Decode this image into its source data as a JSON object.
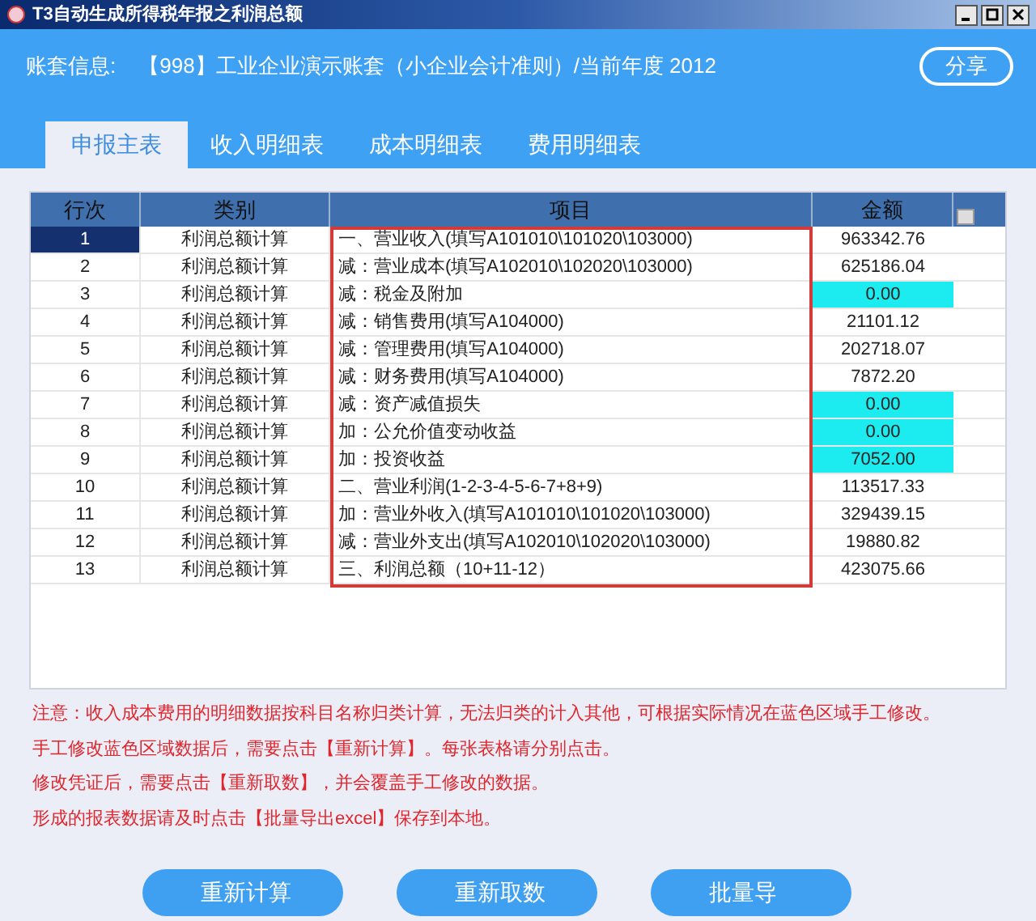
{
  "window": {
    "title": "T3自动生成所得税年报之利润总额"
  },
  "account": {
    "label": "账套信息:",
    "value": "【998】工业企业演示账套（小企业会计准则）/当前年度 2012"
  },
  "share_button": "分享",
  "tabs": [
    {
      "label": "申报主表",
      "selected": true
    },
    {
      "label": "收入明细表",
      "selected": false
    },
    {
      "label": "成本明细表",
      "selected": false
    },
    {
      "label": "费用明细表",
      "selected": false
    }
  ],
  "table": {
    "columns": [
      "行次",
      "类别",
      "项目",
      "金额"
    ],
    "rows": [
      {
        "no": "1",
        "category": "利润总额计算",
        "item": "一、营业收入(填写A101010\\101020\\103000)",
        "amount": "963342.76",
        "selected": true,
        "editable": false
      },
      {
        "no": "2",
        "category": "利润总额计算",
        "item": "减：营业成本(填写A102010\\102020\\103000)",
        "amount": "625186.04",
        "selected": false,
        "editable": false
      },
      {
        "no": "3",
        "category": "利润总额计算",
        "item": "减：税金及附加",
        "amount": "0.00",
        "selected": false,
        "editable": true
      },
      {
        "no": "4",
        "category": "利润总额计算",
        "item": "减：销售费用(填写A104000)",
        "amount": "21101.12",
        "selected": false,
        "editable": false
      },
      {
        "no": "5",
        "category": "利润总额计算",
        "item": "减：管理费用(填写A104000)",
        "amount": "202718.07",
        "selected": false,
        "editable": false
      },
      {
        "no": "6",
        "category": "利润总额计算",
        "item": "减：财务费用(填写A104000)",
        "amount": "7872.20",
        "selected": false,
        "editable": false
      },
      {
        "no": "7",
        "category": "利润总额计算",
        "item": "减：资产减值损失",
        "amount": "0.00",
        "selected": false,
        "editable": true
      },
      {
        "no": "8",
        "category": "利润总额计算",
        "item": "加：公允价值变动收益",
        "amount": "0.00",
        "selected": false,
        "editable": true
      },
      {
        "no": "9",
        "category": "利润总额计算",
        "item": "加：投资收益",
        "amount": "7052.00",
        "selected": false,
        "editable": true
      },
      {
        "no": "10",
        "category": "利润总额计算",
        "item": "二、营业利润(1-2-3-4-5-6-7+8+9)",
        "amount": "113517.33",
        "selected": false,
        "editable": false
      },
      {
        "no": "11",
        "category": "利润总额计算",
        "item": "加：营业外收入(填写A101010\\101020\\103000)",
        "amount": "329439.15",
        "selected": false,
        "editable": false
      },
      {
        "no": "12",
        "category": "利润总额计算",
        "item": "减：营业外支出(填写A102010\\102020\\103000)",
        "amount": "19880.82",
        "selected": false,
        "editable": false
      },
      {
        "no": "13",
        "category": "利润总额计算",
        "item": "三、利润总额（10+11-12）",
        "amount": "423075.66",
        "selected": false,
        "editable": false
      }
    ]
  },
  "notes": [
    "注意：收入成本费用的明细数据按科目名称归类计算，无法归类的计入其他，可根据实际情况在蓝色区域手工修改。",
    "手工修改蓝色区域数据后，需要点击【重新计算】。每张表格请分别点击。",
    "修改凭证后，需要点击【重新取数】，并会覆盖手工修改的数据。",
    "形成的报表数据请及时点击【批量导出excel】保存到本地。"
  ],
  "buttons": [
    "重新计算",
    "重新取数",
    "批量导"
  ]
}
